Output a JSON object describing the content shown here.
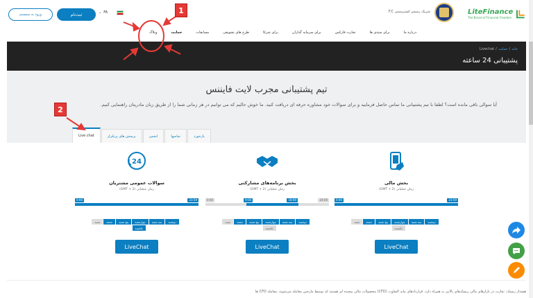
{
  "header": {
    "logo_text": "LiteFinance",
    "logo_tagline": "The Brand of Financial Freedom",
    "partner_text": "شریک رسمی لسترسیتی F.C",
    "register_label": "ثبت‌نام",
    "login_label": "ورود به سیستم",
    "lang_label": "FA"
  },
  "nav": {
    "items": [
      {
        "label": "درباره ما",
        "active": false
      },
      {
        "label": "برای مبتدی ها",
        "active": false
      },
      {
        "label": "تجارت فارکس",
        "active": false
      },
      {
        "label": "برای سرمایه گذاران",
        "active": false
      },
      {
        "label": "برای شرکا",
        "active": false
      },
      {
        "label": "طرح های تشویقی",
        "active": false
      },
      {
        "label": "مسابقات",
        "active": false
      },
      {
        "label": "حمایت",
        "active": true
      },
      {
        "label": "وبلاگ",
        "active": false
      }
    ]
  },
  "band": {
    "breadcrumb_home": "خانه",
    "breadcrumb_support": "حمایت",
    "breadcrumb_current": "Livechat",
    "title": "پشتیبانی 24 ساعته"
  },
  "intro": {
    "title": "تیم پشتیبانی مجرب لایت فایننس",
    "description": "آیا سوالی باقی مانده است؟ لطفا با تیم پشتیبانی ما تماس حاصل فرمایید و برای سوالات خود مشاوره حرفه ای دریافت کنید. ما خوش حالیم که می توانیم در هر زمانی شما را از طریق زبان مادریتان راهنمایی کنیم."
  },
  "tabs": [
    {
      "label": "Live chat",
      "active": true
    },
    {
      "label": "پرسش های پرتکرار",
      "active": false
    },
    {
      "label": "انجمن",
      "active": false
    },
    {
      "label": "تماسها",
      "active": false
    },
    {
      "label": "بازخورد",
      "active": false
    }
  ],
  "cards": [
    {
      "title": "سوالات عمومی مشتریان",
      "subtitle": "زمان عملیاتی (GMT + 2)",
      "icon": "24h-chat-icon",
      "start": "0:00",
      "end": "23:59",
      "days_on": [
        "دوشنبه",
        "سه شنبه",
        "چهارشنبه",
        "پنج شنبه",
        "جمعه",
        "یکشنبه"
      ],
      "days_off": [
        "شنبه"
      ],
      "button": "LiveChat"
    },
    {
      "title": "بخش برنامه‌های مشارکتی",
      "subtitle": "زمان عملیاتی (GMT + 2)",
      "icon": "handshake-icon",
      "start": "0:00",
      "mid_start": "9:00",
      "mid_end": "18:00",
      "end": "24:00",
      "days_on": [
        "دوشنبه",
        "سه شنبه",
        "چهارشنبه",
        "پنج شنبه",
        "جمعه"
      ],
      "days_off": [
        "شنبه",
        "یکشنبه"
      ],
      "button": "LiveChat"
    },
    {
      "title": "بخش مالی",
      "subtitle": "زمان عملیاتی (GMT + 2)",
      "icon": "mobile-payment-icon",
      "start": "0:00",
      "end": "23:59",
      "days_on": [
        "دوشنبه",
        "سه شنبه",
        "چهارشنبه",
        "پنج شنبه",
        "جمعه"
      ],
      "days_off": [
        "شنبه",
        "یکشنبه"
      ],
      "button": "LiveChat"
    }
  ],
  "annotations": {
    "one": "1",
    "two": "2"
  },
  "footer_text": "هشدار ریسک: تجارت در بازارهای مالی ریسک‌های بالایی به همراه دارد. قراردادهای مابه التفاوت (CFD) محصولات مالی پیچیده ای هستند که توسط مارجین معامله می‌شوند. معامله CFD ها",
  "colors": {
    "accent": "#0b7fc1",
    "brand": "#3aa757",
    "annotation": "#e53935"
  }
}
